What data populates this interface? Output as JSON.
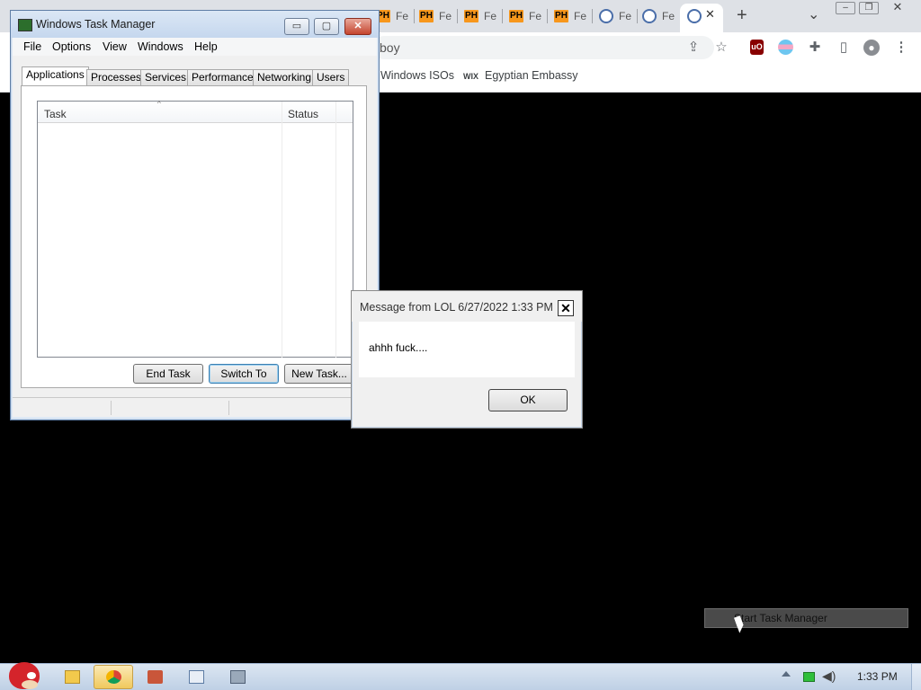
{
  "browser": {
    "tabs": [
      {
        "favicon": "ph-icon",
        "label": "Fe"
      },
      {
        "favicon": "ph-icon",
        "label": "Fe"
      },
      {
        "favicon": "ph-icon",
        "label": "Fe"
      },
      {
        "favicon": "ph-icon",
        "label": "Fe"
      },
      {
        "favicon": "ph-icon",
        "label": "Fe"
      },
      {
        "favicon": "pr-icon",
        "label": "Fe"
      },
      {
        "favicon": "pr-icon",
        "label": "Fe"
      }
    ],
    "address_text": "boy",
    "new_tab_symbol": "+",
    "tab_list_symbol": "⌄",
    "bookmarks": [
      {
        "label": "Windows ISOs"
      },
      {
        "label": "Egyptian Embassy",
        "prefix": "WIX"
      }
    ]
  },
  "task_manager": {
    "title": "Windows Task Manager",
    "menu": [
      "File",
      "Options",
      "View",
      "Windows",
      "Help"
    ],
    "tabs": [
      "Applications",
      "Processes",
      "Services",
      "Performance",
      "Networking",
      "Users"
    ],
    "columns": [
      "Task",
      "Status"
    ],
    "buttons": {
      "end_task": "End Task",
      "switch_to": "Switch To",
      "new_task": "New Task..."
    },
    "caption": {
      "minimize": "▭",
      "maximize": "▢",
      "close": "✕"
    }
  },
  "message_box": {
    "title": "Message from LOL 6/27/2022 1:33 PM",
    "body": "ahhh fuck....",
    "ok": "OK",
    "close_symbol": "✕"
  },
  "context_item": {
    "label": "Start Task Manager"
  },
  "taskbar": {
    "clock": "1:33 PM",
    "pinned": [
      "explorer-icon",
      "chrome-icon",
      "app-icon",
      "window-icon",
      "task-manager-icon"
    ]
  },
  "colors": {
    "titlebar": "#c5d7ee",
    "taskbar": "#bfd0e5",
    "active_taskbar_item": "#f0c95d",
    "ph_badge": "#f7971c"
  }
}
